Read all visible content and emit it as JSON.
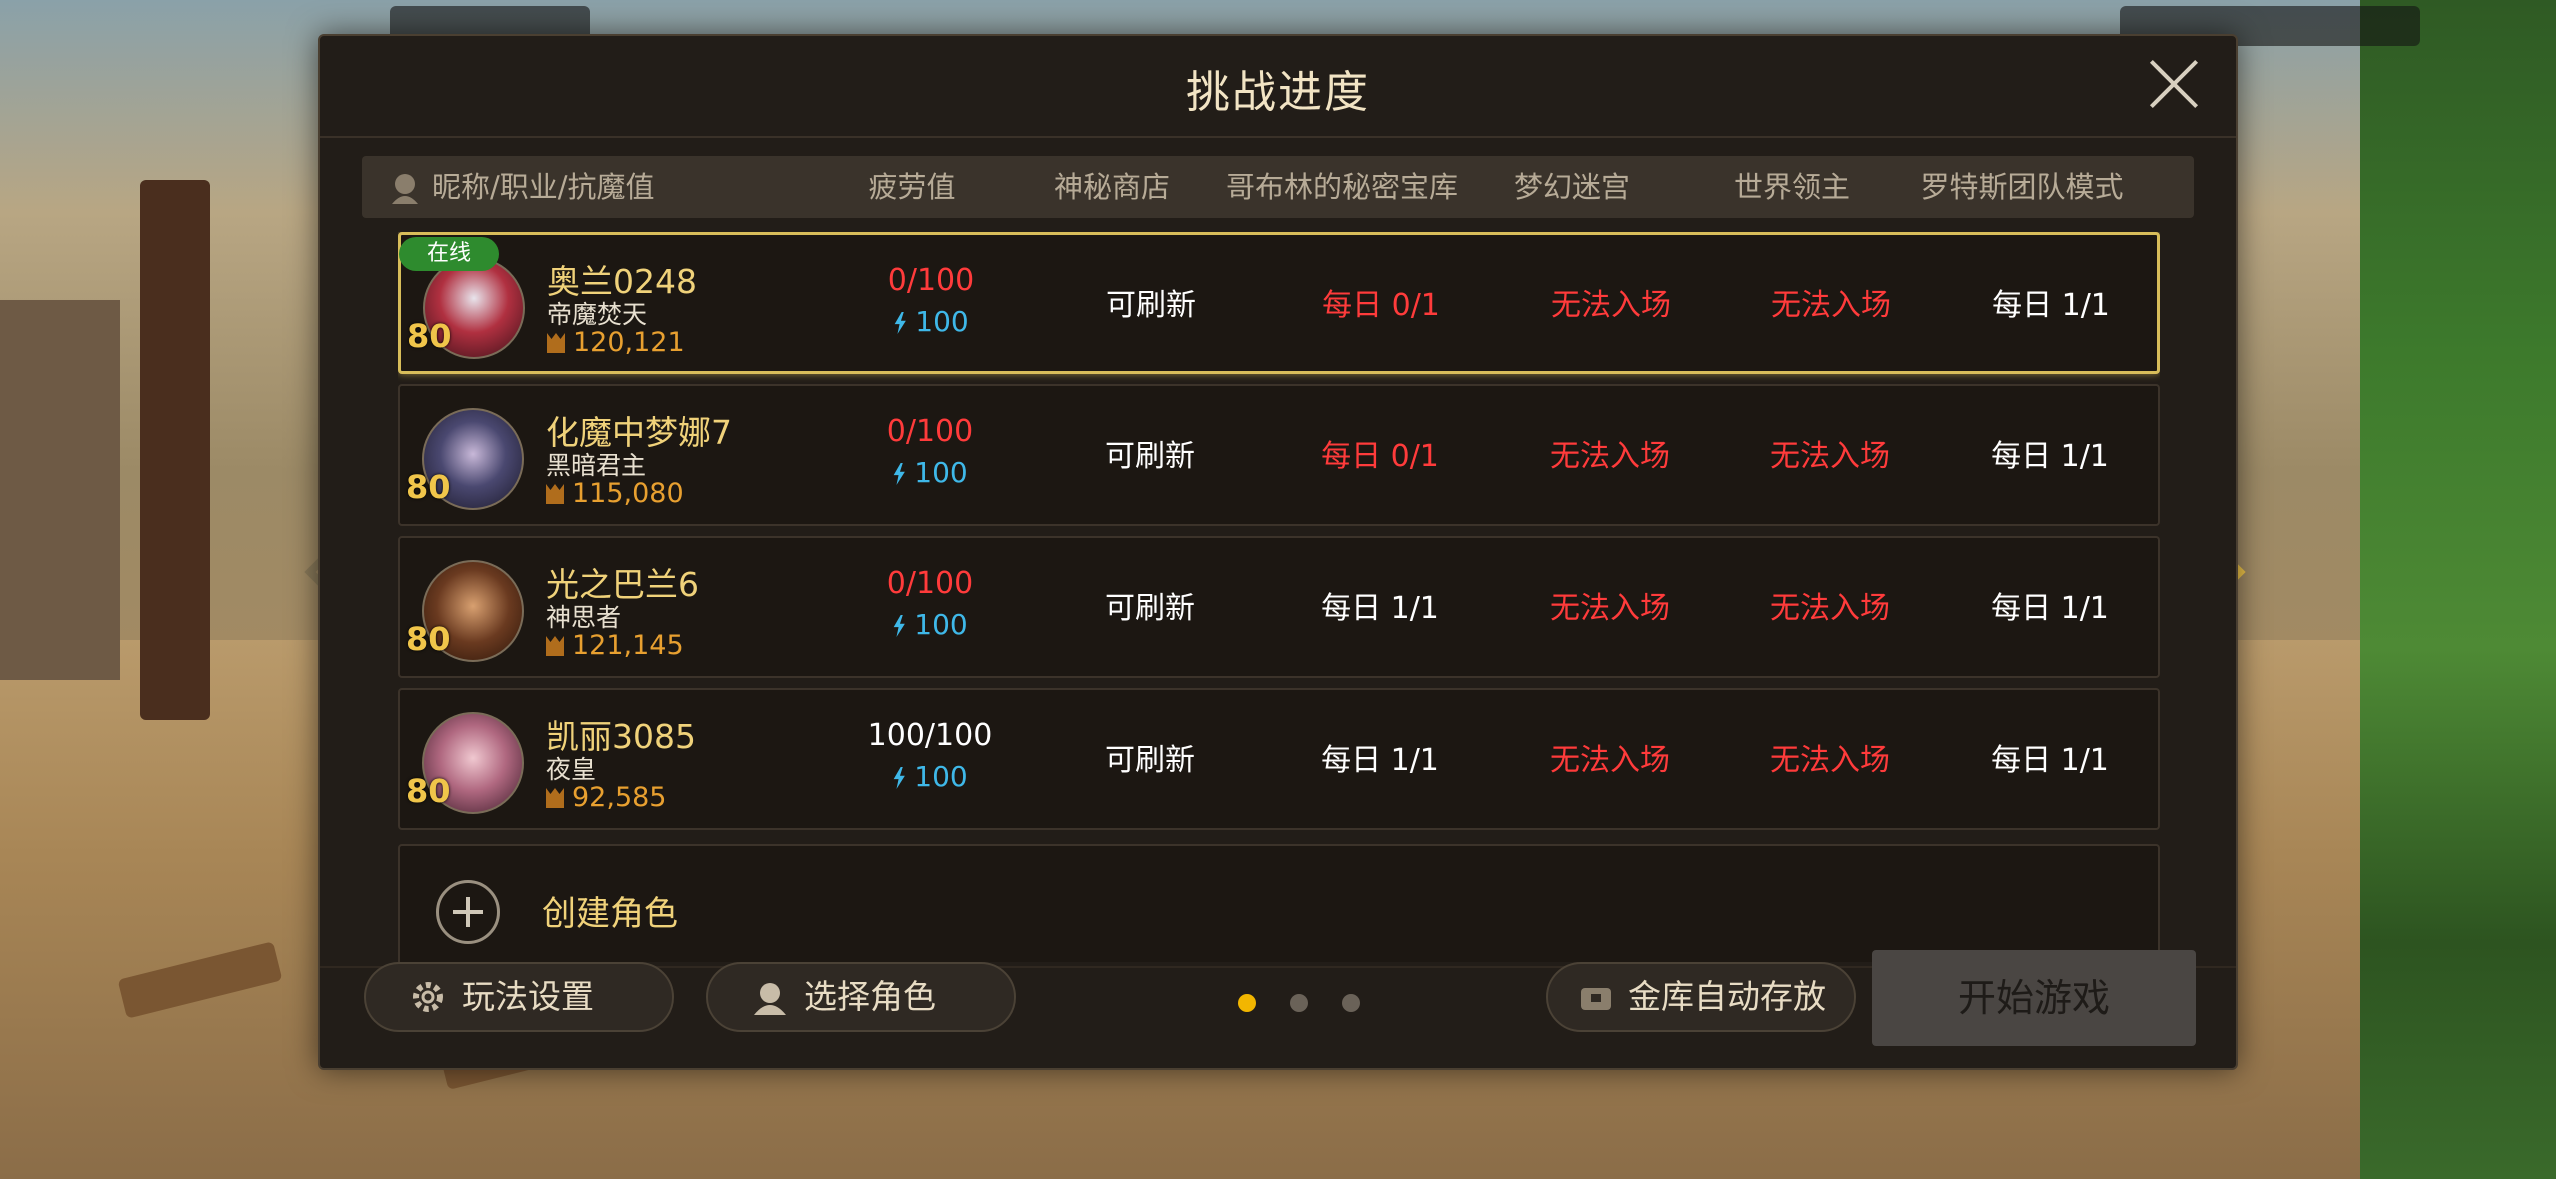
{
  "dialog": {
    "title": "挑战进度"
  },
  "columns": {
    "character": "昵称/职业/抗魔值",
    "fatigue": "疲劳值",
    "shop": "神秘商店",
    "goblin": "哥布林的秘密宝库",
    "maze": "梦幻迷宫",
    "boss": "世界领主",
    "raid": "罗特斯团队模式"
  },
  "characters": [
    {
      "online": "在线",
      "level": "80",
      "name": "奥兰0248",
      "job": "帝魔焚天",
      "power": "120,121",
      "fatigue": "0/100",
      "energy": "100",
      "shop": "可刷新",
      "goblin": "每日 0/1",
      "maze": "无法入场",
      "boss": "无法入场",
      "raid": "每日 1/1"
    },
    {
      "level": "80",
      "name": "化魔中梦娜7",
      "job": "黑暗君主",
      "power": "115,080",
      "fatigue": "0/100",
      "energy": "100",
      "shop": "可刷新",
      "goblin": "每日 0/1",
      "maze": "无法入场",
      "boss": "无法入场",
      "raid": "每日 1/1"
    },
    {
      "level": "80",
      "name": "光之巴兰6",
      "job": "神思者",
      "power": "121,145",
      "fatigue": "0/100",
      "energy": "100",
      "shop": "可刷新",
      "goblin": "每日 1/1",
      "maze": "无法入场",
      "boss": "无法入场",
      "raid": "每日 1/1"
    },
    {
      "level": "80",
      "name": "凯丽3085",
      "job": "夜皇",
      "power": "92,585",
      "fatigue": "100/100",
      "energy": "100",
      "shop": "可刷新",
      "goblin": "每日 1/1",
      "maze": "无法入场",
      "boss": "无法入场",
      "raid": "每日 1/1"
    }
  ],
  "create": {
    "label": "创建角色"
  },
  "footer": {
    "settings": "玩法设置",
    "select_role": "选择角色",
    "auto_store": "金库自动存放",
    "start": "开始游戏",
    "page_count": 3,
    "active_page": 1
  },
  "colors": {
    "highlight_gold": "#d8bd5a",
    "name_gold": "#f0d27a",
    "status_red": "#ff3b3b",
    "energy_blue": "#3fb8e8",
    "online_green": "#2e8b2e",
    "active_dot": "#f2b600"
  }
}
